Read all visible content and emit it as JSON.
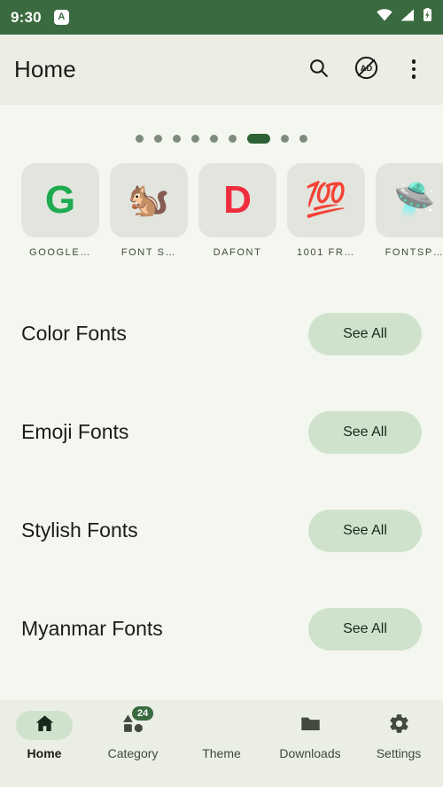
{
  "status_bar": {
    "time": "9:30",
    "app_notification_icon": "app-notification-icon",
    "app_notification_letter": "A",
    "wifi_icon": "wifi-icon",
    "signal_icon": "cellular-signal-icon",
    "battery_icon": "battery-charging-icon",
    "background_color": "#3a6b40"
  },
  "app_bar": {
    "title": "Home",
    "search_icon": "search-icon",
    "remove_ads_icon": "remove-ads-icon",
    "remove_ads_label": "AD",
    "overflow_icon": "more-vertical-icon",
    "background_color": "#eceee6"
  },
  "carousel": {
    "total_dots": 9,
    "active_index": 6,
    "active_color": "#2d6236",
    "inactive_color": "#7f8c7c"
  },
  "sources": [
    {
      "label": "GOOGLE…",
      "icon": "google-g-icon",
      "glyph": "G",
      "glyph_color": "#1eaa4f",
      "kind": "letter"
    },
    {
      "label": "FONT S…",
      "icon": "squirrel-icon",
      "glyph": "🐿️",
      "kind": "emoji"
    },
    {
      "label": "DAFONT",
      "icon": "dafont-d-icon",
      "glyph": "D",
      "glyph_color": "#ef2d3f",
      "kind": "letter"
    },
    {
      "label": "1001 FR…",
      "icon": "hundred-points-icon",
      "glyph": "💯",
      "kind": "emoji"
    },
    {
      "label": "FONTSP…",
      "icon": "flying-saucer-icon",
      "glyph": "🛸",
      "kind": "emoji"
    }
  ],
  "categories": [
    {
      "title": "Color Fonts",
      "action_label": "See All"
    },
    {
      "title": "Emoji Fonts",
      "action_label": "See All"
    },
    {
      "title": "Stylish Fonts",
      "action_label": "See All"
    },
    {
      "title": "Myanmar Fonts",
      "action_label": "See All"
    }
  ],
  "bottom_nav": {
    "active_index": 0,
    "items": [
      {
        "label": "Home",
        "icon": "home-icon"
      },
      {
        "label": "Category",
        "icon": "category-shapes-icon",
        "badge": "24"
      },
      {
        "label": "Theme",
        "icon": "palette-icon"
      },
      {
        "label": "Downloads",
        "icon": "folder-icon"
      },
      {
        "label": "Settings",
        "icon": "gear-icon"
      }
    ]
  },
  "theme": {
    "accent": "#3a6b40",
    "chip_bg": "#cfe3cc",
    "page_bg": "#f4f7ef"
  }
}
